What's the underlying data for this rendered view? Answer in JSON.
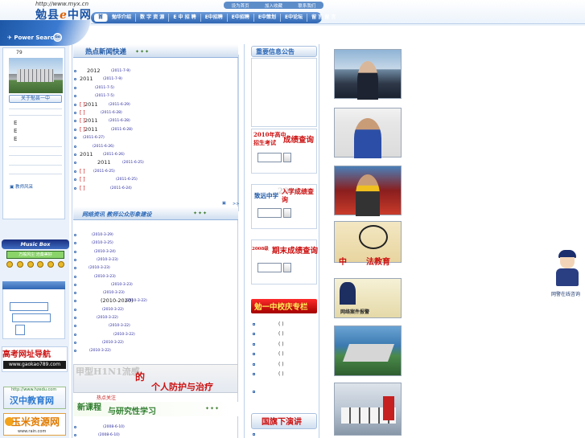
{
  "header": {
    "url": "http://www.myx.cn",
    "logo_prefix": "勉县",
    "logo_e": "e",
    "logo_suffix": "中网",
    "top_links": [
      "设为首页",
      "加入收藏",
      "联系我们"
    ]
  },
  "nav": {
    "items": [
      "首页",
      "勉县介绍",
      "数字资源",
      "E中招聘",
      "E中招聘",
      "E中招聘"
    ],
    "labels": [
      "首",
      "勉华介绍",
      "数 字 资 源",
      "E 中 招 聘",
      "E中招聘",
      "E中招聘",
      "E中策划",
      "E中论坛",
      "留 言 留 言"
    ]
  },
  "left": {
    "search_label": "Power Search",
    "search_go": "Go",
    "date_num": "79",
    "about_label": "关于勉县一中",
    "e_items": [
      "E",
      "E",
      "E"
    ],
    "teacher_link": "教师风采",
    "music_title": "Music Box",
    "music_sub": "万般风尘 沧桑美好",
    "ad_gaokao_title": "高考网址导航",
    "ad_gaokao_url": "www.gaokao789.com",
    "ad_hanzhong_url": "http://www.hzedu.com",
    "ad_hanzhong_title": "汉中教育网",
    "ad_yumi_title": "玉米资源网",
    "ad_yumi_url": "www.rain.com"
  },
  "news": {
    "title": "热点新闻快递",
    "deco": "✦✦✦",
    "rows": [
      {
        "text": "2012",
        "date": "(2011-7-9)"
      },
      {
        "text": "2011",
        "date": "(2011-7-9)"
      },
      {
        "text": "",
        "date": "(2011-7-5)"
      },
      {
        "text": "",
        "date": "(2011-7-5)"
      },
      {
        "text": "2011",
        "date": "(2011-6-29)",
        "bracket": "[ ]"
      },
      {
        "text": "",
        "date": "(2011-6-28)",
        "bracket": "[ ]"
      },
      {
        "text": "2011",
        "date": "(2011-6-28)",
        "bracket": "[ ]"
      },
      {
        "text": "2011",
        "date": "(2011-6-28)",
        "bracket": "[ ]"
      },
      {
        "text": "",
        "date": "(2011-6-27)"
      },
      {
        "text": "",
        "date": "(2011-6-26)"
      },
      {
        "text": "2011",
        "date": "(2011-6-26)"
      },
      {
        "text": "2011",
        "date": "(2011-6-25)"
      },
      {
        "text": "",
        "date": "(2011-6-25)",
        "bracket": "[ ]"
      },
      {
        "text": "",
        "date": "(2011-6-25)",
        "bracket": "[ ]"
      },
      {
        "text": "",
        "date": "(2011-6-24)",
        "bracket": "[ ]"
      }
    ],
    "more": ">>"
  },
  "network": {
    "title": "网络资讯  教师公众形象建设",
    "rows": [
      {
        "date": "(2010-3-29)"
      },
      {
        "date": "(2010-3-25)"
      },
      {
        "date": "(2010-3-24)"
      },
      {
        "date": "(2010-3-23)"
      },
      {
        "date": "(2010-3-23)"
      },
      {
        "date": "(2010-3-23)"
      },
      {
        "date": "(2010-3-23)"
      },
      {
        "date": "(2010-3-23)"
      },
      {
        "text": "(2010-2020)",
        "date": "(2010-3-22)"
      },
      {
        "date": "(2010-3-22)"
      },
      {
        "date": "(2010-3-22)"
      },
      {
        "date": "(2010-3-22)"
      },
      {
        "date": "(2010-3-22)"
      },
      {
        "date": "(2010-3-22)"
      },
      {
        "date": "(2010-3-22)"
      }
    ]
  },
  "banner": {
    "a": "甲型H1N1流感",
    "b": "的",
    "c": "个人防护与治疗",
    "d": "热点关注"
  },
  "kecheng": {
    "a": "新课程",
    "b": "与研究性学习",
    "rows": [
      {
        "date": "(2008-6-10)"
      },
      {
        "date": "(2008-6-10)"
      }
    ]
  },
  "column3": {
    "notice_title": "重要信息公告",
    "q1_title_a": "2010年高中",
    "q1_title_b": "招生考试",
    "q1_big": "成绩查询",
    "q2_ghost": "2010",
    "q2_small": "致远中学",
    "q2_big": "入学成绩查询",
    "q3_a": "2008级",
    "q3_b": "期末成绩查询",
    "anniv_title": "勉一中校庆专栏",
    "anniv_rows": [
      "( )",
      "( )",
      "( )",
      "( )",
      "( )",
      "( )"
    ],
    "flag_title": "国旗下演讲"
  },
  "photos": {
    "p4_text_a": "中",
    "p4_text_b": "法教育",
    "p5_text": "网络案件报警"
  },
  "police": {
    "label": "网警在线咨询"
  },
  "colors": {
    "brand_blue": "#1d57a6",
    "accent_red": "#cc1111",
    "accent_orange": "#e06000"
  }
}
